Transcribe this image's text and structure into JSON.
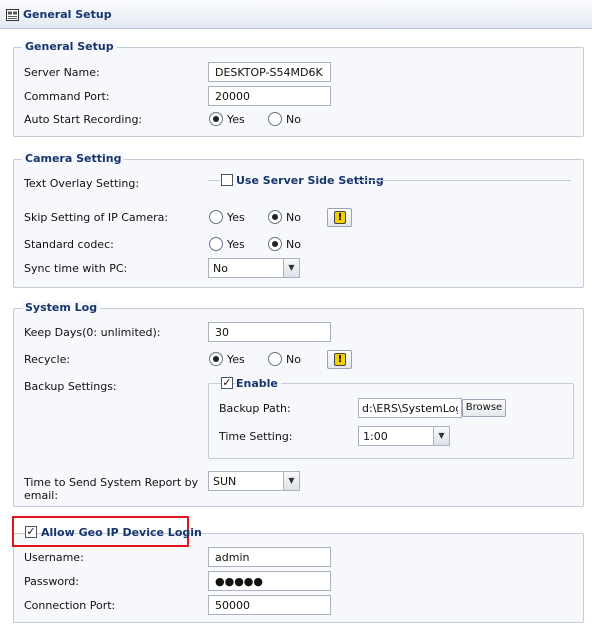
{
  "window": {
    "title": "General Setup",
    "icon": "server-icon"
  },
  "general_setup": {
    "legend": "General Setup",
    "server_name_label": "Server Name:",
    "server_name_value": "DESKTOP-S54MD6K",
    "command_port_label": "Command Port:",
    "command_port_value": "20000",
    "auto_start_label": "Auto Start Recording:",
    "yes_label": "Yes",
    "no_label": "No",
    "auto_start_selected": "Yes"
  },
  "camera_setting": {
    "legend": "Camera Setting",
    "text_overlay_label": "Text Overlay Setting:",
    "use_server_side_label": "Use Server Side Setting",
    "use_server_side_checked": false,
    "skip_setting_label": "Skip Setting of IP Camera:",
    "skip_yes": "Yes",
    "skip_no": "No",
    "skip_selected": "No",
    "standard_codec_label": "Standard codec:",
    "codec_yes": "Yes",
    "codec_no": "No",
    "codec_selected": "No",
    "sync_time_label": "Sync time with PC:",
    "sync_time_value": "No"
  },
  "system_log": {
    "legend": "System Log",
    "keep_days_label": "Keep Days(0: unlimited):",
    "keep_days_value": "30",
    "recycle_label": "Recycle:",
    "recycle_yes": "Yes",
    "recycle_no": "No",
    "recycle_selected": "Yes",
    "backup_settings_label": "Backup Settings:",
    "enable_label": "Enable",
    "enable_checked": true,
    "backup_path_label": "Backup Path:",
    "backup_path_value": "d:\\ERS\\SystemLog",
    "browse_label": "Browse",
    "time_setting_label": "Time Setting:",
    "time_setting_value": "1:00",
    "report_label_line1": "Time to Send System Report by",
    "report_label_line2": "email:",
    "report_day_value": "SUN"
  },
  "geo_ip": {
    "legend": "Allow Geo IP Device Login",
    "checked": true,
    "username_label": "Username:",
    "username_value": "admin",
    "password_label": "Password:",
    "password_value": "●●●●●",
    "port_label": "Connection Port:",
    "port_value": "50000"
  },
  "colors": {
    "legend_text": "#17356c",
    "panel_bg": "#f6f8fc",
    "panel_border": "#c3ccd9",
    "highlight_box": "#e3151a",
    "warning_icon": "#f2d000"
  }
}
